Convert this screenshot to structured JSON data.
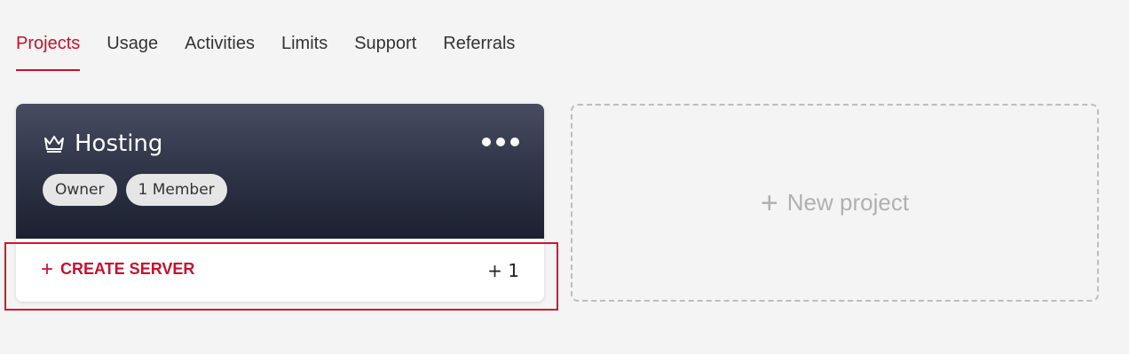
{
  "nav": {
    "tabs": [
      {
        "label": "Projects",
        "active": true
      },
      {
        "label": "Usage",
        "active": false
      },
      {
        "label": "Activities",
        "active": false
      },
      {
        "label": "Limits",
        "active": false
      },
      {
        "label": "Support",
        "active": false
      },
      {
        "label": "Referrals",
        "active": false
      }
    ]
  },
  "project_card": {
    "icon": "crown-icon",
    "title": "Hosting",
    "menu_icon": "more-horizontal-icon",
    "badges": [
      "Owner",
      "1 Member"
    ],
    "create_server_icon": "plus-icon",
    "create_server_label": "CREATE SERVER",
    "extra_count": "+ 1"
  },
  "new_project": {
    "icon": "plus-icon",
    "label": "New project"
  },
  "colors": {
    "accent": "#c8102e",
    "background": "#f4f4f4",
    "card_top_gradient_start": "#474c61",
    "card_top_gradient_end": "#1c2030",
    "badge_bg": "#e6e6e6",
    "muted_text": "#b0b0b0"
  }
}
